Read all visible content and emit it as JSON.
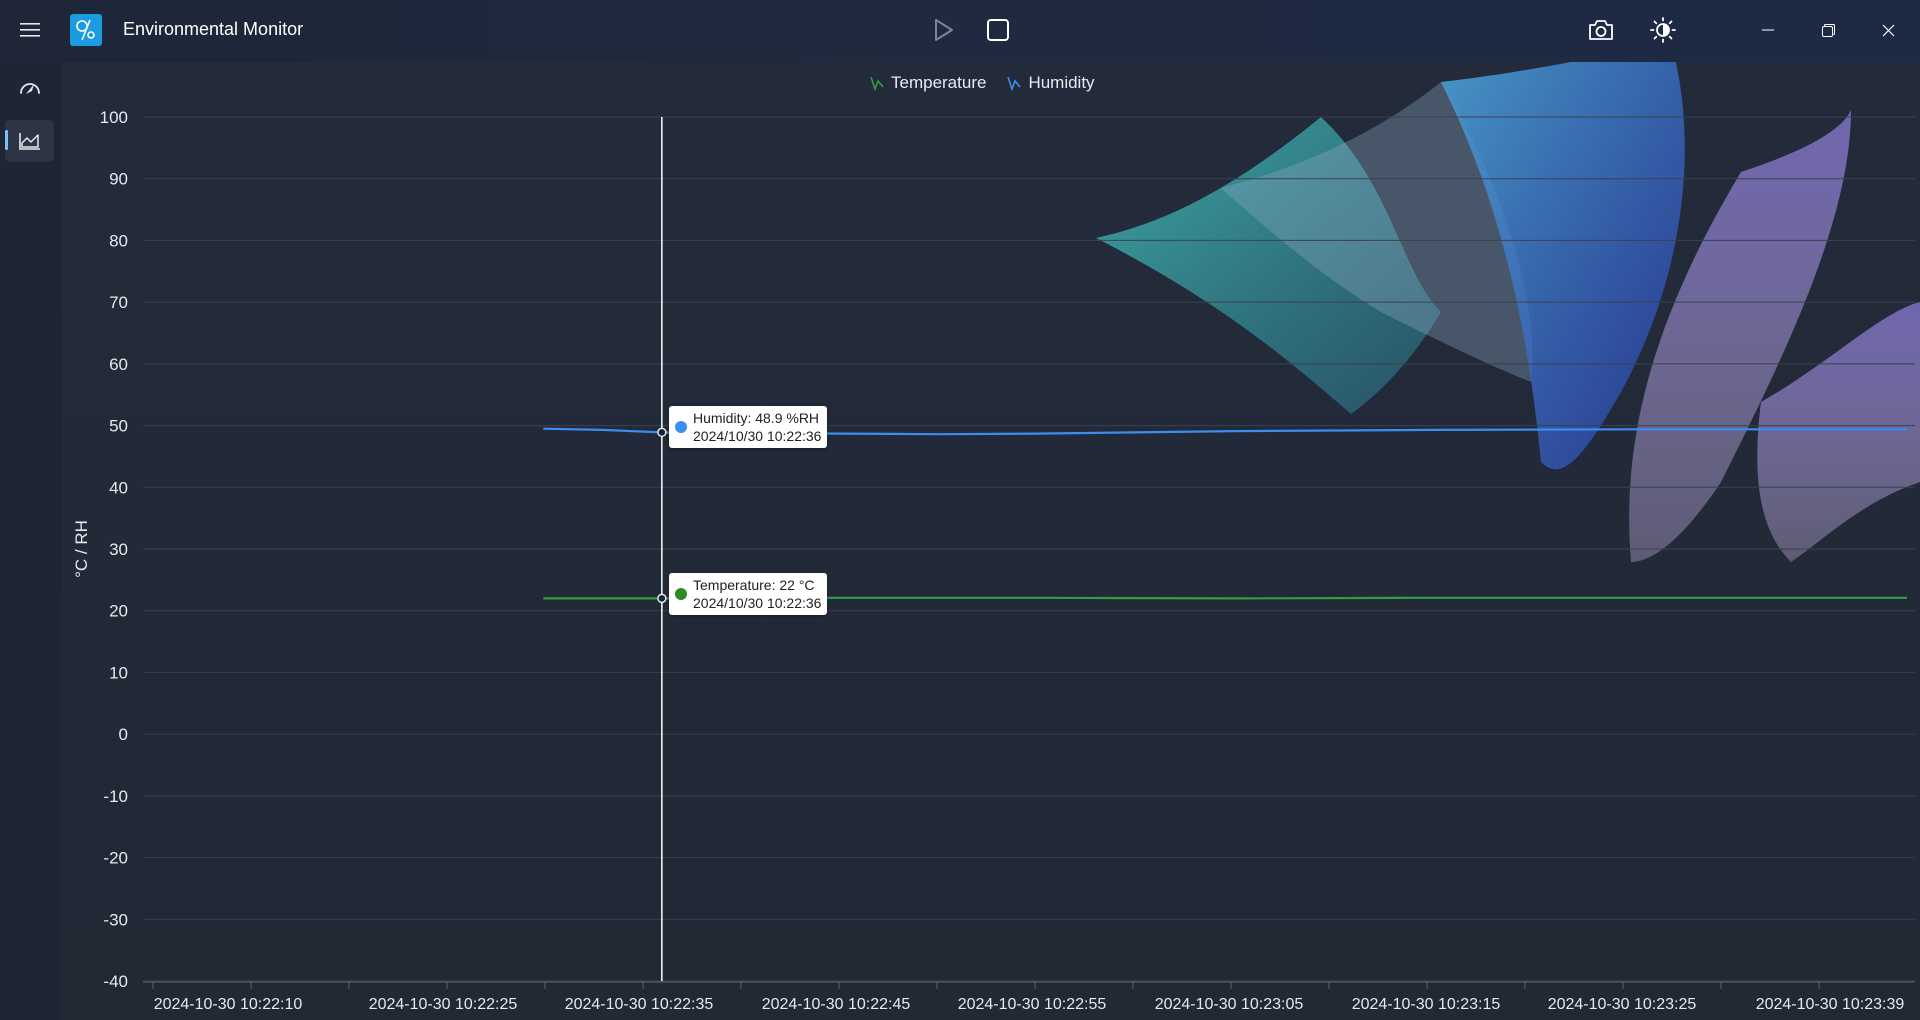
{
  "app": {
    "title": "Environmental Monitor"
  },
  "titlebar_icons": [
    "hamburger-menu-icon",
    "app-logo-icon",
    "play-icon",
    "stop-icon",
    "camera-icon",
    "brightness-icon",
    "minimize-icon",
    "restore-icon",
    "close-icon"
  ],
  "sidebar": {
    "items": [
      {
        "icon": "gauge-icon"
      },
      {
        "icon": "area-chart-icon",
        "selected": true
      }
    ]
  },
  "colors": {
    "temperature": "#2ea043",
    "humidity": "#3b8ef0",
    "accent": "#1b9ce0"
  },
  "chart_data": {
    "type": "line",
    "ylabel": "°C / RH",
    "ylim": [
      -40,
      100
    ],
    "y_ticks": [
      "100",
      "90",
      "80",
      "70",
      "60",
      "50",
      "40",
      "30",
      "20",
      "10",
      "0",
      "-10",
      "-20",
      "-30",
      "-40"
    ],
    "x_tick_labels": [
      "2024-10-30 10:22:10",
      "2024-10-30 10:22:25",
      "2024-10-30 10:22:35",
      "2024-10-30 10:22:45",
      "2024-10-30 10:22:55",
      "2024-10-30 10:23:05",
      "2024-10-30 10:23:15",
      "2024-10-30 10:23:25",
      "2024-10-30 10:23:39"
    ],
    "legend": "top-center",
    "grid": true,
    "series": [
      {
        "name": "Temperature",
        "x": [
          "10:22:30",
          "10:22:36",
          "10:22:45",
          "10:22:55",
          "10:23:05",
          "10:23:15",
          "10:23:25",
          "10:23:39"
        ],
        "values": [
          22.0,
          22.0,
          22.1,
          22.1,
          22.0,
          22.1,
          22.1,
          22.1
        ]
      },
      {
        "name": "Humidity",
        "x": [
          "10:22:30",
          "10:22:33",
          "10:22:36",
          "10:22:40",
          "10:22:45",
          "10:22:50",
          "10:22:55",
          "10:23:05",
          "10:23:15",
          "10:23:25",
          "10:23:39"
        ],
        "values": [
          49.5,
          49.3,
          48.9,
          48.8,
          48.7,
          48.6,
          48.7,
          49.1,
          49.3,
          49.4,
          49.4
        ]
      }
    ],
    "cursor": "2024/10/30 10:22:36",
    "tooltips": [
      {
        "series": "Humidity",
        "text": "Humidity: 48.9 %RH",
        "time": "2024/10/30 10:22:36"
      },
      {
        "series": "Temperature",
        "text": "Temperature: 22 °C",
        "time": "2024/10/30 10:22:36"
      }
    ]
  }
}
